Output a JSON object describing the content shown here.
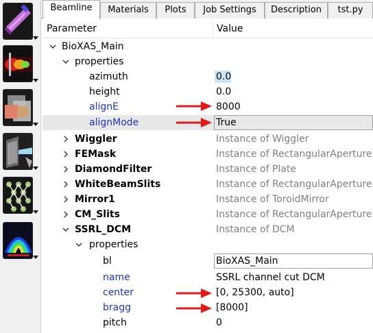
{
  "toolbar": {
    "buttons": [
      {
        "icon": "beamline-source-icon"
      },
      {
        "icon": "optics-icon"
      },
      {
        "icon": "materials-icon"
      },
      {
        "icon": "screens-icon"
      },
      {
        "icon": "crystal-lattice-icon"
      },
      {
        "icon": "plots-icon"
      }
    ]
  },
  "tabs": [
    {
      "label": "Beamline",
      "active": true
    },
    {
      "label": "Materials"
    },
    {
      "label": "Plots"
    },
    {
      "label": "Job Settings"
    },
    {
      "label": "Description"
    },
    {
      "label": "tst.py"
    }
  ],
  "tree": {
    "headers": {
      "parameter": "Parameter",
      "value": "Value"
    },
    "rows": [
      {
        "label": "BioXAS_Main",
        "value": "",
        "expand": "open"
      },
      {
        "label": "properties",
        "value": "",
        "expand": "open"
      },
      {
        "label": "azimuth",
        "value": "0.0"
      },
      {
        "label": "height",
        "value": "0.0"
      },
      {
        "label": "alignE",
        "value": "8000"
      },
      {
        "label": "alignMode",
        "value": "True"
      },
      {
        "label": "Wiggler",
        "value": "Instance of Wiggler",
        "expand": "closed"
      },
      {
        "label": "FEMask",
        "value": "Instance of RectangularAperture",
        "expand": "closed"
      },
      {
        "label": "DiamondFilter",
        "value": "Instance of Plate",
        "expand": "closed"
      },
      {
        "label": "WhiteBeamSlits",
        "value": "Instance of RectangularAperture",
        "expand": "closed"
      },
      {
        "label": "Mirror1",
        "value": "Instance of ToroidMirror",
        "expand": "closed"
      },
      {
        "label": "CM_Slits",
        "value": "Instance of RectangularAperture",
        "expand": "closed"
      },
      {
        "label": "SSRL_DCM",
        "value": "Instance of DCM",
        "expand": "open"
      },
      {
        "label": "properties",
        "value": "",
        "expand": "open"
      },
      {
        "label": "bl",
        "value": "BioXAS_Main"
      },
      {
        "label": "name",
        "value": "SSRL channel cut DCM"
      },
      {
        "label": "center",
        "value": "[0, 25300, auto]"
      },
      {
        "label": "bragg",
        "value": "[8000]"
      },
      {
        "label": "pitch",
        "value": "0"
      }
    ]
  },
  "colors": {
    "modified_param": "#1c33c8",
    "instance_value": "#7f7f7f",
    "annotation_arrow": "#e41a1a",
    "selection": "#e8e8e8",
    "value_focus": "#cce4f7"
  }
}
